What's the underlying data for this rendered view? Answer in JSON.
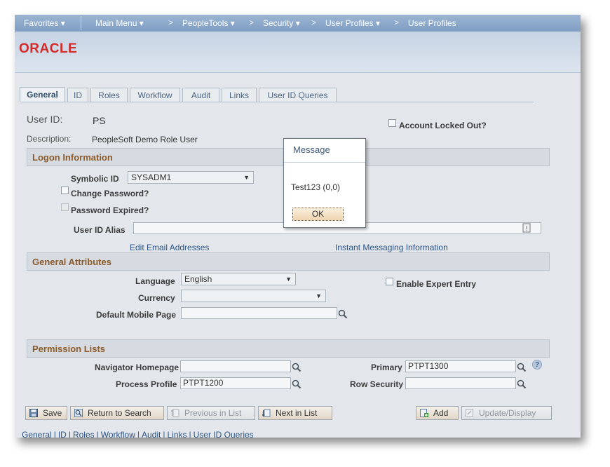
{
  "nav": {
    "favorites": "Favorites",
    "main_menu": "Main Menu",
    "peopletools": "PeopleTools",
    "security": "Security",
    "user_profiles_menu": "User Profiles",
    "current": "User Profiles",
    "sep": ">"
  },
  "logo": "ORACLE",
  "tabs": [
    "General",
    "ID",
    "Roles",
    "Workflow",
    "Audit",
    "Links",
    "User ID Queries"
  ],
  "user": {
    "id_label": "User ID:",
    "id_value": "PS",
    "desc_label": "Description:",
    "desc_value": "PeopleSoft Demo Role User",
    "account_locked_label": "Account Locked Out?"
  },
  "logon": {
    "section_title": "Logon Information",
    "symbolic_id_label": "Symbolic ID",
    "symbolic_id_value": "SYSADM1",
    "change_password_label": "Change Password?",
    "password_expired_label": "Password Expired?",
    "user_id_alias_label": "User ID Alias",
    "user_id_alias_value": "",
    "edit_email_link": "Edit Email Addresses",
    "instant_messaging_link": "Instant Messaging Information"
  },
  "general_attributes": {
    "section_title": "General Attributes",
    "language_label": "Language",
    "language_value": "English",
    "currency_label": "Currency",
    "currency_value": "",
    "default_mobile_label": "Default Mobile Page",
    "default_mobile_value": "",
    "enable_expert_label": "Enable Expert Entry"
  },
  "permission_lists": {
    "section_title": "Permission Lists",
    "navigator_homepage_label": "Navigator Homepage",
    "navigator_homepage_value": "",
    "process_profile_label": "Process Profile",
    "process_profile_value": "PTPT1200",
    "primary_label": "Primary",
    "primary_value": "PTPT1300",
    "row_security_label": "Row Security",
    "row_security_value": ""
  },
  "buttons": {
    "save": "Save",
    "return_to_search": "Return to Search",
    "previous_in_list": "Previous in List",
    "next_in_list": "Next in List",
    "add": "Add",
    "update_display": "Update/Display"
  },
  "bottom_links": [
    "General",
    "ID",
    "Roles",
    "Workflow",
    "Audit",
    "Links",
    "User ID Queries"
  ],
  "bottom_sep": "|",
  "dialog": {
    "title": "Message",
    "message": "Test123 (0,0)",
    "ok": "OK"
  },
  "help_glyph": "?",
  "colors": {
    "brand_red": "#d2292a",
    "section_title": "#8b5a2b",
    "link_blue": "#2d5486"
  }
}
